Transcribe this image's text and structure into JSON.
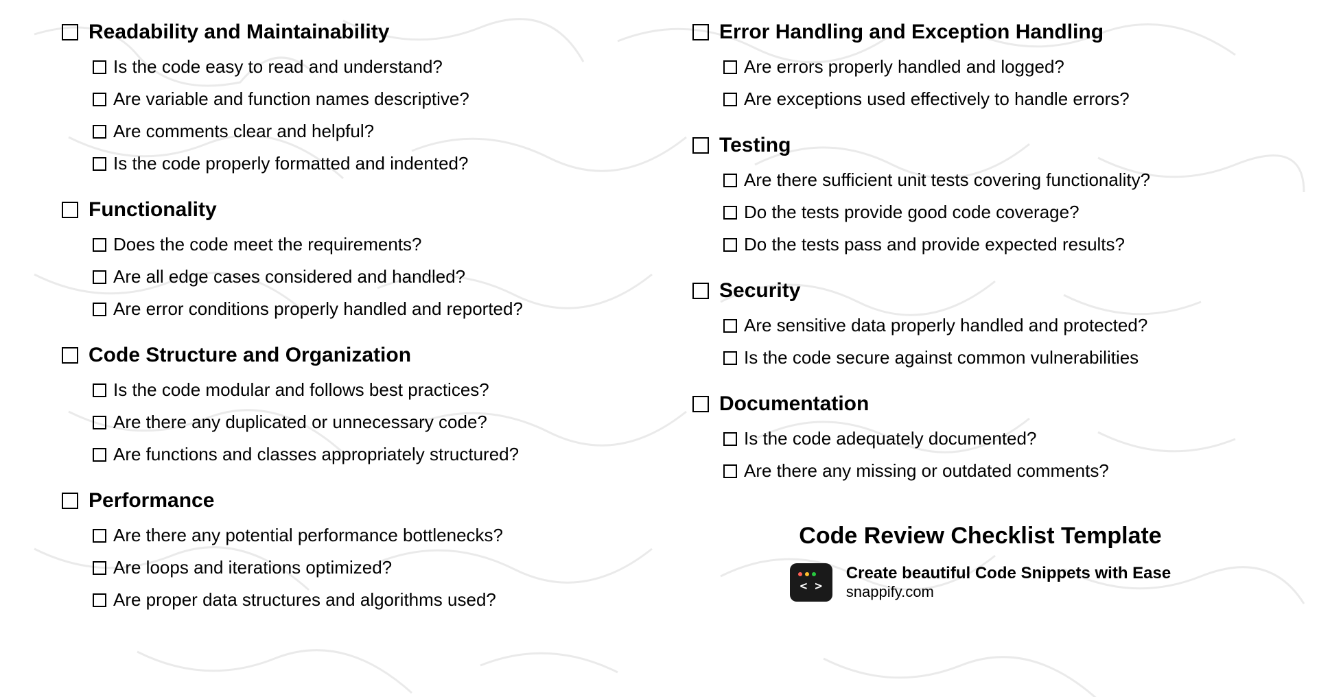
{
  "sections": [
    {
      "title": "Readability and Maintainability",
      "items": [
        "Is the code easy to read and understand?",
        "Are variable and function names descriptive?",
        "Are comments clear and helpful?",
        "Is the code properly formatted and indented?"
      ]
    },
    {
      "title": "Functionality",
      "items": [
        "Does the code meet the requirements?",
        "Are all edge cases considered and handled?",
        "Are error conditions properly handled and reported?"
      ]
    },
    {
      "title": "Code Structure and Organization",
      "items": [
        "Is the code modular and follows best practices?",
        "Are there any duplicated or unnecessary code?",
        "Are functions and classes appropriately structured?"
      ]
    },
    {
      "title": "Performance",
      "items": [
        "Are there any potential performance bottlenecks?",
        "Are loops and iterations optimized?",
        "Are proper data structures and algorithms used?"
      ]
    },
    {
      "title": "Error Handling and Exception Handling",
      "items": [
        "Are errors properly handled and logged?",
        "Are exceptions used effectively to handle errors?"
      ]
    },
    {
      "title": "Testing",
      "items": [
        "Are there sufficient unit tests covering functionality?",
        "Do the tests provide good code coverage?",
        "Do the tests pass and provide expected results?"
      ]
    },
    {
      "title": "Security",
      "items": [
        "Are sensitive data properly handled and protected?",
        "Is the code secure against common vulnerabilities"
      ]
    },
    {
      "title": "Documentation",
      "items": [
        "Is the code adequately documented?",
        "Are there any missing or outdated comments?"
      ]
    }
  ],
  "footer": {
    "title": "Code Review Checklist Template",
    "tagline": "Create beautiful Code Snippets with Ease",
    "url": "snappify.com",
    "logo_code": "< >"
  }
}
